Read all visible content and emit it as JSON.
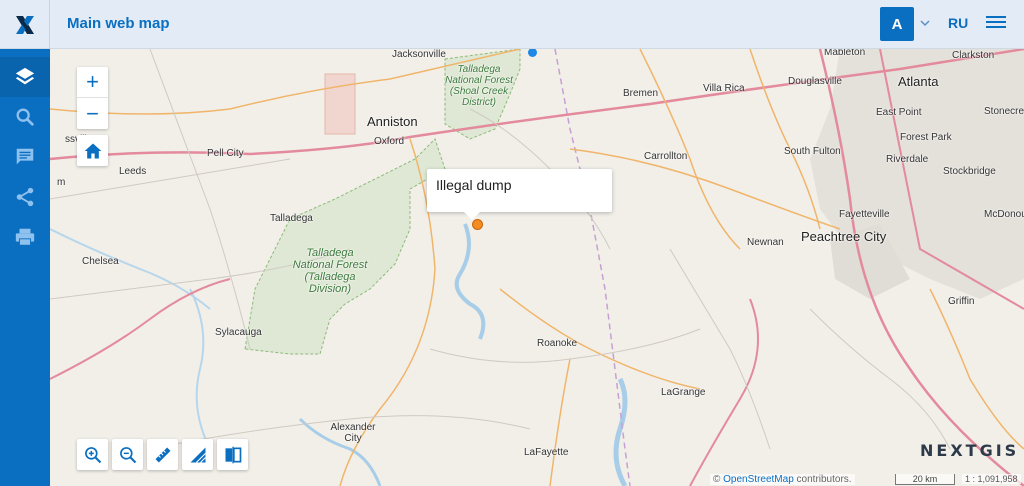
{
  "header": {
    "title": "Main web map",
    "avatar_letter": "A",
    "language": "RU"
  },
  "sidebar": {
    "items": [
      {
        "icon": "layers-icon",
        "name": "sidebar-item-layers"
      },
      {
        "icon": "search-icon",
        "name": "sidebar-item-search"
      },
      {
        "icon": "annotations-icon",
        "name": "sidebar-item-annotations"
      },
      {
        "icon": "share-icon",
        "name": "sidebar-item-share"
      },
      {
        "icon": "print-icon",
        "name": "sidebar-item-print"
      }
    ]
  },
  "map": {
    "zoom_in": "+",
    "zoom_out": "−",
    "popup_text": "Illegal dump",
    "brand": "NEXTGIS",
    "attribution_prefix": "©",
    "attribution_link": "OpenStreetMap",
    "attribution_suffix": "contributors.",
    "scale_label": "20 km",
    "scale_ratio": "1 : 1,091,958",
    "places": {
      "jacksonville": "Jacksonville",
      "mableton": "Mableton",
      "clarkston": "Clarkston",
      "atlanta": "Atlanta",
      "douglasville": "Douglasville",
      "bremen": "Bremen",
      "villa_rica": "Villa Rica",
      "east_point": "East Point",
      "stonecrest": "Stonecre",
      "forest_park": "Forest Park",
      "anniston": "Anniston",
      "oxford": "Oxford",
      "pell_city": "Pell City",
      "gadsville": "ssville",
      "leeds": "Leeds",
      "carrollton": "Carrollton",
      "south_fulton": "South Fulton",
      "riverdale": "Riverdale",
      "stockbridge": "Stockbridge",
      "fayetteville": "Fayetteville",
      "mcdonough": "McDonou",
      "talladega": "Talladega",
      "newnan": "Newnan",
      "peachtree": "Peachtree City",
      "chelsea": "Chelsea",
      "griffin": "Griffin",
      "sylacauga": "Sylacauga",
      "roanoke": "Roanoke",
      "lagrange": "LaGrange",
      "alexander_city": "Alexander City",
      "lafayette": "LaFayette",
      "bham": "m"
    },
    "forests": {
      "shoal_creek": "Talladega National Forest (Shoal Creek District)",
      "talladega_div": "Talladega National Forest (Talladega Division)"
    }
  }
}
